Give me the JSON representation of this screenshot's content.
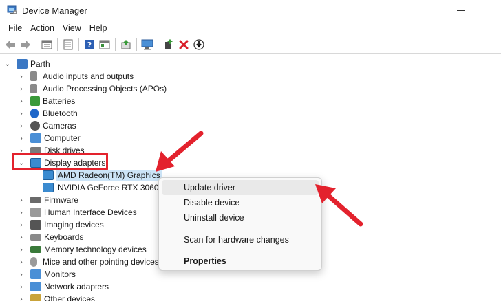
{
  "window": {
    "title": "Device Manager"
  },
  "menubar": {
    "items": [
      "File",
      "Action",
      "View",
      "Help"
    ]
  },
  "toolbar": {
    "buttons": [
      "back-arrow-icon",
      "forward-arrow-icon",
      "properties-icon",
      "list-icon",
      "help-icon",
      "view-icon",
      "update-driver-icon",
      "monitor-icon",
      "add-driver-icon",
      "uninstall-icon",
      "download-icon"
    ]
  },
  "tree": {
    "root": "Parth",
    "categories": [
      "Audio inputs and outputs",
      "Audio Processing Objects (APOs)",
      "Batteries",
      "Bluetooth",
      "Cameras",
      "Computer",
      "Disk drives",
      "Display adapters",
      "Firmware",
      "Human Interface Devices",
      "Imaging devices",
      "Keyboards",
      "Memory technology devices",
      "Mice and other pointing devices",
      "Monitors",
      "Network adapters",
      "Other devices"
    ],
    "display_adapters": [
      "AMD Radeon(TM) Graphics",
      "NVIDIA GeForce RTX 3060 La"
    ]
  },
  "context_menu": {
    "items": [
      "Update driver",
      "Disable device",
      "Uninstall device",
      "Scan for hardware changes",
      "Properties"
    ]
  },
  "colors": {
    "highlight": "#e3222d",
    "selection": "#cce4f7",
    "arrow": "#e3222d"
  }
}
